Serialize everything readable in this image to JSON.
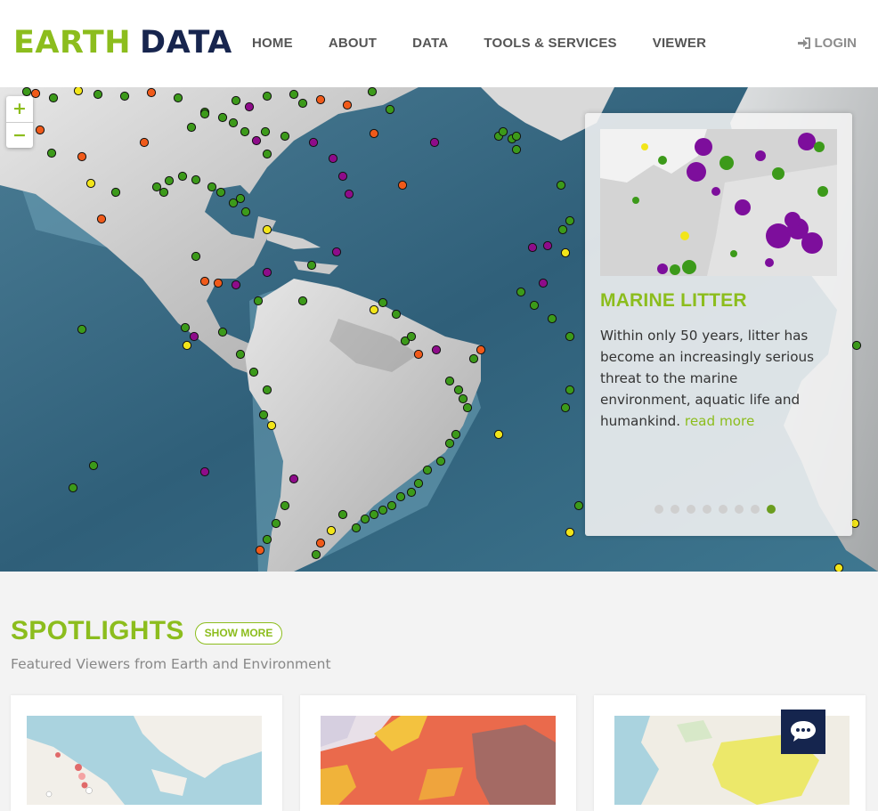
{
  "header": {
    "logo_part1": "EARTH",
    "logo_part2": "DATA",
    "nav": [
      "HOME",
      "ABOUT",
      "DATA",
      "TOOLS & SERVICES",
      "VIEWER"
    ],
    "login_label": "LOGIN",
    "brand_green": "#8cbd1d",
    "brand_navy": "#17254e"
  },
  "map": {
    "zoom_in_label": "+",
    "zoom_out_label": "−",
    "marker_colors": [
      "#3c9a1a",
      "#f05a1a",
      "#f2e51a",
      "#8e0c8a"
    ]
  },
  "slide": {
    "title": "MARINE LITTER",
    "text": "Within only 50 years, litter has become an increasingly serious threat to the marine environment, aquatic life and humankind.",
    "link_label": "read more",
    "dot_count": 8,
    "active_dot": 8
  },
  "spotlights": {
    "title": "SPOTLIGHTS",
    "show_more_label": "SHOW MORE",
    "subtitle": "Featured Viewers from Earth and Environment"
  },
  "icons": {
    "login": "sign-in-icon",
    "chat": "chat-bubble-icon"
  }
}
